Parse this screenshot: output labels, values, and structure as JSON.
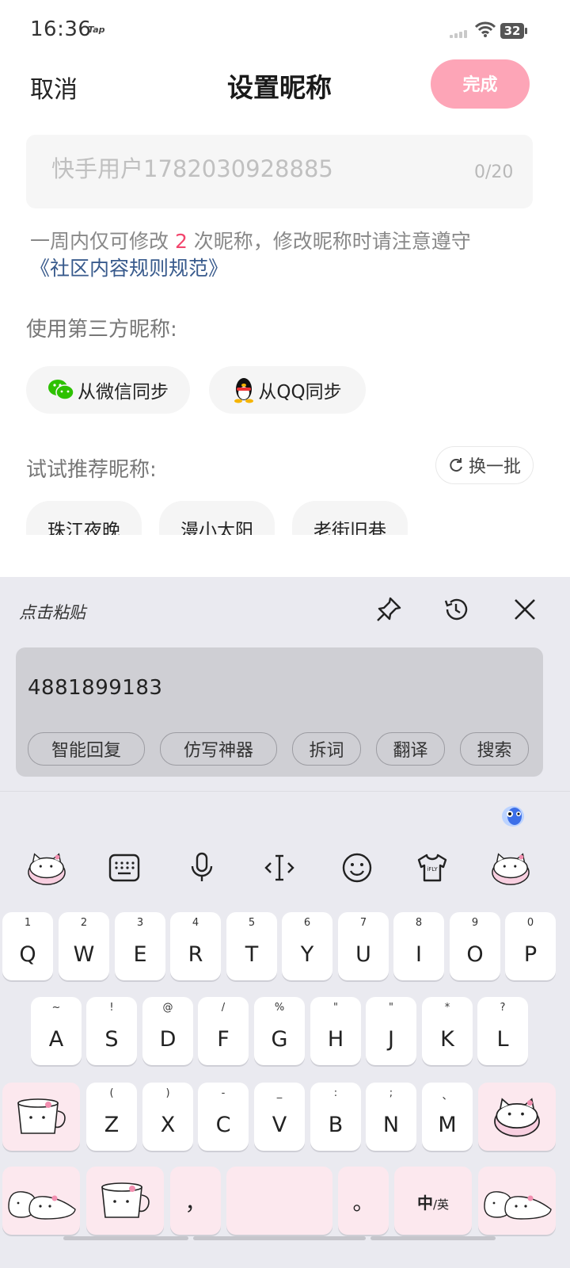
{
  "status": {
    "time": "16:36",
    "tap": "Tap",
    "battery": "32"
  },
  "header": {
    "cancel": "取消",
    "title": "设置昵称",
    "done": "完成"
  },
  "nickname": {
    "placeholder": "快手用户1782030928885",
    "counter": "0/20"
  },
  "hint": {
    "part1": "一周内仅可修改 ",
    "count": "2",
    "part2": " 次昵称，修改昵称时请注意遵守",
    "rules_link": "《社区内容规则规范》"
  },
  "third_party": {
    "label": "使用第三方昵称:",
    "wechat": "从微信同步",
    "qq": "从QQ同步"
  },
  "recommend": {
    "label": "试试推荐昵称:",
    "refresh": "换一批",
    "names": [
      "珠江夜晚",
      "漫小太阳",
      "老街旧巷"
    ]
  },
  "clipboard": {
    "title": "点击粘贴",
    "text": "4881899183",
    "actions": [
      "智能回复",
      "仿写神器",
      "拆词",
      "翻译",
      "搜索"
    ]
  },
  "keyboard": {
    "row1": [
      [
        "Q",
        "1"
      ],
      [
        "W",
        "2"
      ],
      [
        "E",
        "3"
      ],
      [
        "R",
        "4"
      ],
      [
        "T",
        "5"
      ],
      [
        "Y",
        "6"
      ],
      [
        "U",
        "7"
      ],
      [
        "I",
        "8"
      ],
      [
        "O",
        "9"
      ],
      [
        "P",
        "0"
      ]
    ],
    "row2": [
      [
        "A",
        "~"
      ],
      [
        "S",
        "!"
      ],
      [
        "D",
        "@"
      ],
      [
        "F",
        "/"
      ],
      [
        "G",
        "%"
      ],
      [
        "H",
        "\""
      ],
      [
        "J",
        "\""
      ],
      [
        "K",
        "*"
      ],
      [
        "L",
        "?"
      ]
    ],
    "row3": [
      [
        "Z",
        "("
      ],
      [
        "X",
        ")"
      ],
      [
        "C",
        "-"
      ],
      [
        "V",
        "_"
      ],
      [
        "B",
        ":"
      ],
      [
        "N",
        ";"
      ],
      [
        "M",
        "、"
      ]
    ],
    "comma": "，",
    "period": "。",
    "lang_main": "中",
    "lang_alt": "/英"
  },
  "colors": {
    "accent_pink": "#fda5b7",
    "highlight": "#f2466d",
    "link": "#385a8c"
  }
}
